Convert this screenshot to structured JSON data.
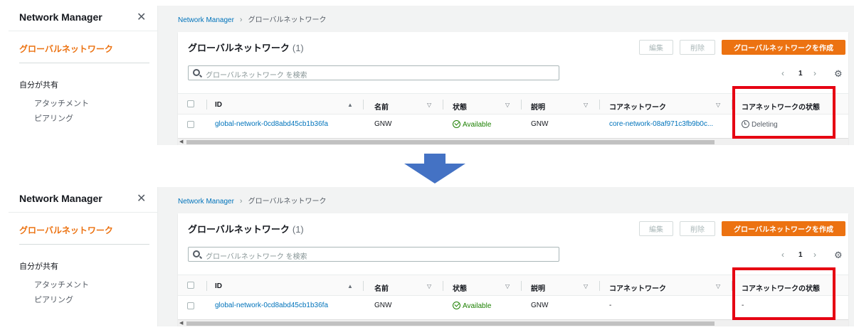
{
  "panels": [
    {
      "sidebar": {
        "title": "Network Manager",
        "close": "✕",
        "active_item": "グローバルネットワーク",
        "section": "自分が共有",
        "sub_items": [
          "アタッチメント",
          "ピアリング"
        ]
      },
      "breadcrumb": {
        "root": "Network Manager",
        "separator": "›",
        "current": "グローバルネットワーク"
      },
      "card": {
        "title": "グローバルネットワーク",
        "count": "(1)",
        "buttons": {
          "edit": "編集",
          "delete": "削除",
          "create": "グローバルネットワークを作成"
        },
        "search_placeholder": "グローバルネットワーク を検索",
        "pager": {
          "prev": "‹",
          "page": "1",
          "next": "›"
        },
        "settings_icon": "⚙",
        "columns": [
          "ID",
          "名前",
          "状態",
          "説明",
          "コアネットワーク",
          "コアネットワークの状態"
        ],
        "sort_asc": "▲",
        "sort_none": "▽",
        "row": {
          "id": "global-network-0cd8abd45cb1b36fa",
          "name": "GNW",
          "state": "Available",
          "description": "GNW",
          "core_network": "core-network-08af971c3fb9b0c...",
          "core_state": "Deleting"
        }
      }
    },
    {
      "sidebar": {
        "title": "Network Manager",
        "close": "✕",
        "active_item": "グローバルネットワーク",
        "section": "自分が共有",
        "sub_items": [
          "アタッチメント",
          "ピアリング"
        ]
      },
      "breadcrumb": {
        "root": "Network Manager",
        "separator": "›",
        "current": "グローバルネットワーク"
      },
      "card": {
        "title": "グローバルネットワーク",
        "count": "(1)",
        "buttons": {
          "edit": "編集",
          "delete": "削除",
          "create": "グローバルネットワークを作成"
        },
        "search_placeholder": "グローバルネットワーク を検索",
        "pager": {
          "prev": "‹",
          "page": "1",
          "next": "›"
        },
        "settings_icon": "⚙",
        "columns": [
          "ID",
          "名前",
          "状態",
          "説明",
          "コアネットワーク",
          "コアネットワークの状態"
        ],
        "sort_asc": "▲",
        "sort_none": "▽",
        "row": {
          "id": "global-network-0cd8abd45cb1b36fa",
          "name": "GNW",
          "state": "Available",
          "description": "GNW",
          "core_network": "-",
          "core_state": "-"
        }
      }
    }
  ],
  "colors": {
    "accent": "#ec7211",
    "link": "#0073bb",
    "success": "#1d8102",
    "highlight": "#e60012",
    "arrow": "#4472c4"
  }
}
